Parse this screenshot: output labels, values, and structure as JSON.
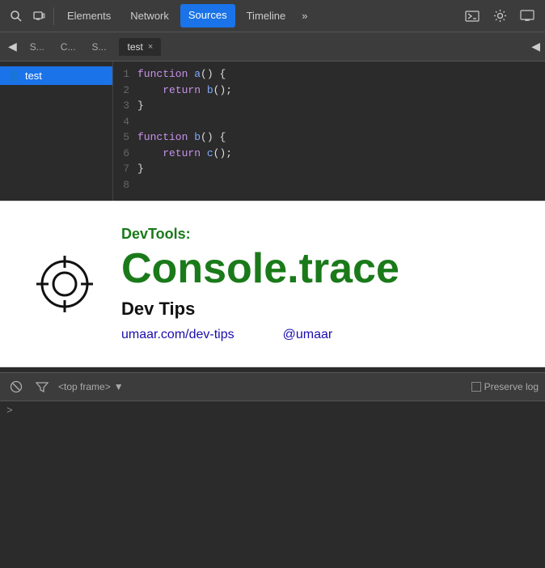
{
  "toolbar": {
    "tabs": [
      {
        "label": "Elements",
        "active": false
      },
      {
        "label": "Network",
        "active": false
      },
      {
        "label": "Sources",
        "active": true
      },
      {
        "label": "Timeline",
        "active": false
      }
    ],
    "more_label": "»",
    "terminal_icon": "⌨",
    "gear_icon": "⚙",
    "monitor_icon": "🖥"
  },
  "second_bar": {
    "nav_back": "◀",
    "panels": [
      "S...",
      "C...",
      "S..."
    ],
    "active_file": "test",
    "close_x": "×",
    "panel_right": "◀"
  },
  "file_tree": {
    "items": [
      {
        "label": "test",
        "icon": "👤",
        "selected": true
      }
    ]
  },
  "code_editor": {
    "lines": [
      {
        "num": "1",
        "code": "function a() {"
      },
      {
        "num": "2",
        "code": "    return b();"
      },
      {
        "num": "3",
        "code": "}"
      },
      {
        "num": "4",
        "code": ""
      },
      {
        "num": "5",
        "code": "function b() {"
      },
      {
        "num": "6",
        "code": "    return c();"
      },
      {
        "num": "7",
        "code": "}"
      },
      {
        "num": "8",
        "code": ""
      }
    ]
  },
  "overlay": {
    "subtitle": "DevTools:",
    "title": "Console.trace",
    "tagline": "Dev Tips",
    "link1": "umaar.com/dev-tips",
    "link2": "@umaar"
  },
  "console_bar": {
    "clear_icon": "🚫",
    "filter_icon": "🔍",
    "dropdown_label": "<top frame>",
    "dropdown_arrow": "▼",
    "preserve_log": "Preserve log"
  },
  "console_area": {
    "prompt_arrow": ">"
  }
}
